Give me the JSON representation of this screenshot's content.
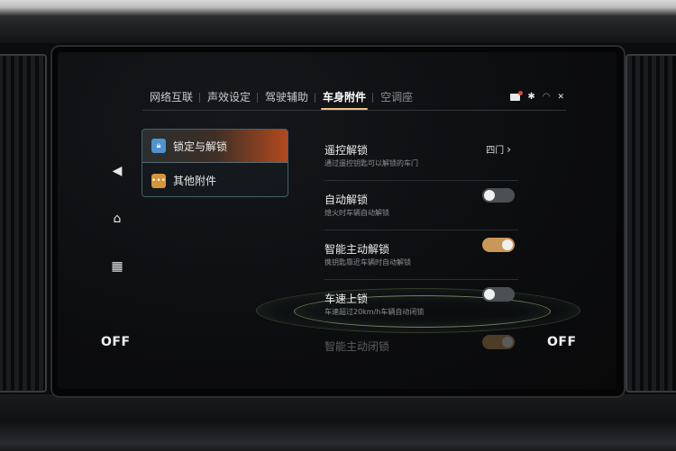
{
  "tabs": [
    {
      "label": "网络互联"
    },
    {
      "label": "声效设定"
    },
    {
      "label": "驾驶辅助"
    },
    {
      "label": "车身附件"
    },
    {
      "label": "空调座"
    }
  ],
  "categories": [
    {
      "label": "锁定与解锁",
      "icon": "lock-icon"
    },
    {
      "label": "其他附件",
      "icon": "more-icon"
    }
  ],
  "settings": [
    {
      "title": "遥控解锁",
      "subtitle": "通过遥控钥匙可以解锁的车门",
      "value": "四门"
    },
    {
      "title": "自动解锁",
      "subtitle": "熄火时车辆自动解锁",
      "state": "off"
    },
    {
      "title": "智能主动解锁",
      "subtitle": "携钥匙靠近车辆时自动解锁",
      "state": "on"
    },
    {
      "title": "车速上锁",
      "subtitle": "车速超过20km/h车辆自动闭锁",
      "state": "off"
    },
    {
      "title": "智能主动闭锁",
      "state": "on"
    }
  ],
  "climate": {
    "left": "OFF",
    "right": "OFF"
  },
  "colors": {
    "accent": "#f1c08a",
    "toggle_on": "#c99856",
    "toggle_off": "#4a5053"
  }
}
